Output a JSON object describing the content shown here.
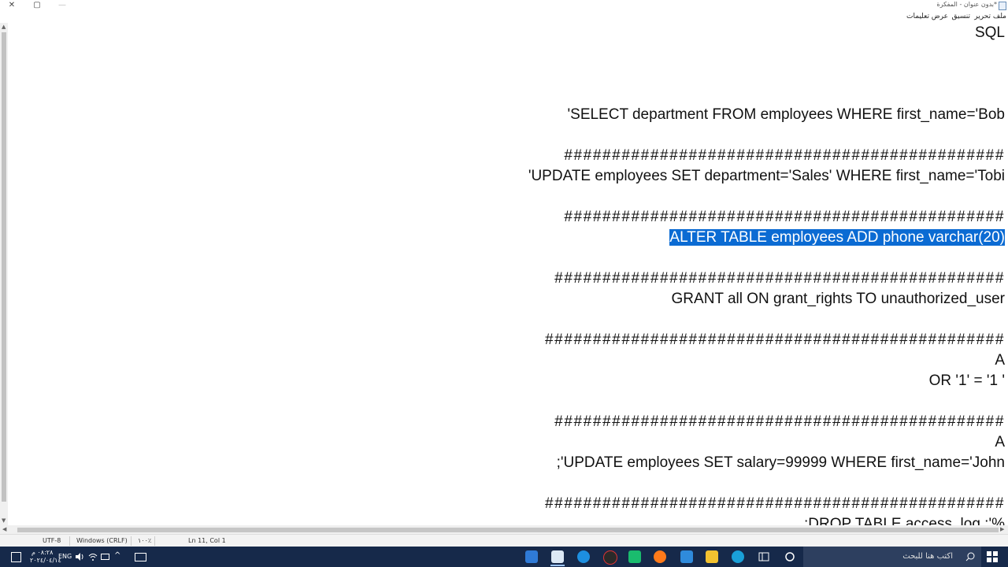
{
  "window": {
    "title": "*بدون عنوان - المفكرة",
    "controls": {
      "close": "✕",
      "maximize": "▢",
      "minimize": "—"
    }
  },
  "menu": [
    "ملف",
    "تحرير",
    "تنسيق",
    "عرض",
    "تعليمات"
  ],
  "editor": {
    "lines": [
      "SQL",
      "SELECT department FROM employees WHERE first_name='Bob'",
      "##############################################",
      "UPDATE employees SET department='Sales' WHERE first_name='Tobi'",
      "##############################################",
      "ALTER TABLE employees ADD phone varchar(20)",
      "###############################################",
      "GRANT all ON grant_rights TO unauthorized_user",
      "################################################",
      "A",
      "' OR '1' = '1",
      "###############################################",
      "A",
      "UPDATE employees SET salary=99999 WHERE first_name='John';",
      "################################################",
      "%'; DROP TABLE access_log;"
    ],
    "selected_line_index": 5
  },
  "status": {
    "position": "Ln 11, Col 1",
    "zoom": "١٠٠٪",
    "line_ending": "Windows (CRLF)",
    "encoding": "UTF-8"
  },
  "taskbar": {
    "search_placeholder": "اكتب هنا للبحث",
    "language": "ENG",
    "time": "٠٨:٢٨ م",
    "date": "٢٠٢٤/٠٤/١٤",
    "apps": [
      "task-view",
      "edge",
      "file-explorer",
      "mail",
      "firefox",
      "green-app",
      "obs",
      "sandbox",
      "notepad",
      "onenote"
    ]
  },
  "colors": {
    "selection": "#0b6bd3",
    "taskbar": "#16294a"
  }
}
